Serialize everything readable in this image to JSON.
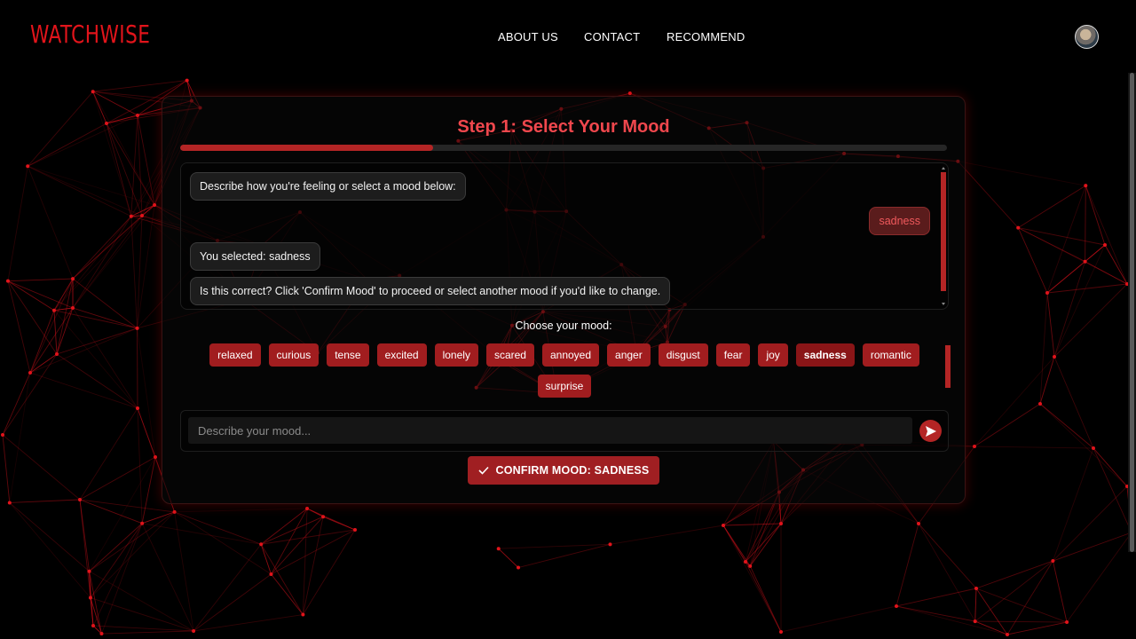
{
  "header": {
    "logo": "WATCHWISE",
    "nav": [
      "ABOUT US",
      "CONTACT",
      "RECOMMEND"
    ]
  },
  "step": {
    "title": "Step 1: Select Your Mood",
    "progress_fraction": 0.33
  },
  "chat": {
    "messages": [
      {
        "from": "bot",
        "text": "Describe how you're feeling or select a mood below:"
      },
      {
        "from": "user",
        "text": "sadness"
      },
      {
        "from": "bot",
        "text": "You selected: sadness"
      },
      {
        "from": "bot",
        "text": "Is this correct? Click 'Confirm Mood' to proceed or select another mood if you'd like to change."
      }
    ]
  },
  "moods": {
    "label": "Choose your mood:",
    "options": [
      "relaxed",
      "curious",
      "tense",
      "excited",
      "lonely",
      "scared",
      "annoyed",
      "anger",
      "disgust",
      "fear",
      "joy",
      "sadness",
      "romantic",
      "surprise"
    ],
    "selected": "sadness"
  },
  "input": {
    "placeholder": "Describe your mood...",
    "value": ""
  },
  "confirm": {
    "label": "CONFIRM MOOD: SADNESS"
  },
  "colors": {
    "brand": "#e1141b",
    "accent": "#b42525",
    "title": "#f0474d"
  }
}
